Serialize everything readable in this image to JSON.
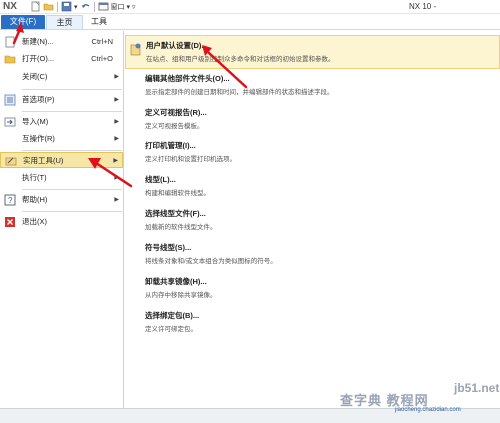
{
  "title_bar": {
    "logo": "NX",
    "window_menu": "窗口",
    "window_title": "NX 10 -"
  },
  "ribbon": {
    "tabs": [
      {
        "label": "文件(F)"
      },
      {
        "label": "主页"
      },
      {
        "label": "工具"
      }
    ]
  },
  "file_menu": {
    "items": [
      {
        "label": "新建(N)...",
        "shortcut": "Ctrl+N"
      },
      {
        "label": "打开(O)...",
        "shortcut": "Ctrl+O"
      },
      {
        "label": "关闭(C)"
      },
      {
        "label": "首选项(P)"
      },
      {
        "label": "导入(M)"
      },
      {
        "label": "互操作(R)"
      },
      {
        "label": "实用工具(U)"
      },
      {
        "label": "执行(T)"
      },
      {
        "label": "帮助(H)"
      },
      {
        "label": "退出(X)"
      }
    ]
  },
  "utilities_submenu": {
    "items": [
      {
        "title": "用户默认设置(D)...",
        "desc": "在站点、组和用户级别控制众多命令和对话框的初始设置和参数。"
      },
      {
        "title": "编辑其他部件文件头(O)...",
        "desc": "显示指定部件的创建日期和时间，并编辑部件的状态和描述字段。"
      },
      {
        "title": "定义可视报告(R)...",
        "desc": "定义可视报告模板。"
      },
      {
        "title": "打印机管理(I)...",
        "desc": "定义打印机和设置打印机选项。"
      },
      {
        "title": "线型(L)...",
        "desc": "构建和编辑软件线型。"
      },
      {
        "title": "选择线型文件(F)...",
        "desc": "加载新的软件线型文件。"
      },
      {
        "title": "符号线型(S)...",
        "desc": "将线条对象和/或文本组合为类似图标的符号。"
      },
      {
        "title": "卸载共享镜像(H)...",
        "desc": "从内存中移除共享镜像。"
      },
      {
        "title": "选择绑定包(B)...",
        "desc": "定义许可绑定包。"
      }
    ]
  },
  "colors": {
    "file_tab": "#2b6ec6",
    "selected_item": "#f6e7a6",
    "highlight_item": "#fdf5d2",
    "arrow": "#e0101a"
  },
  "watermark": {
    "line1": "jb51.net",
    "line2": "查字典 教程网",
    "line3": "jiaocheng.chazidian.com"
  }
}
